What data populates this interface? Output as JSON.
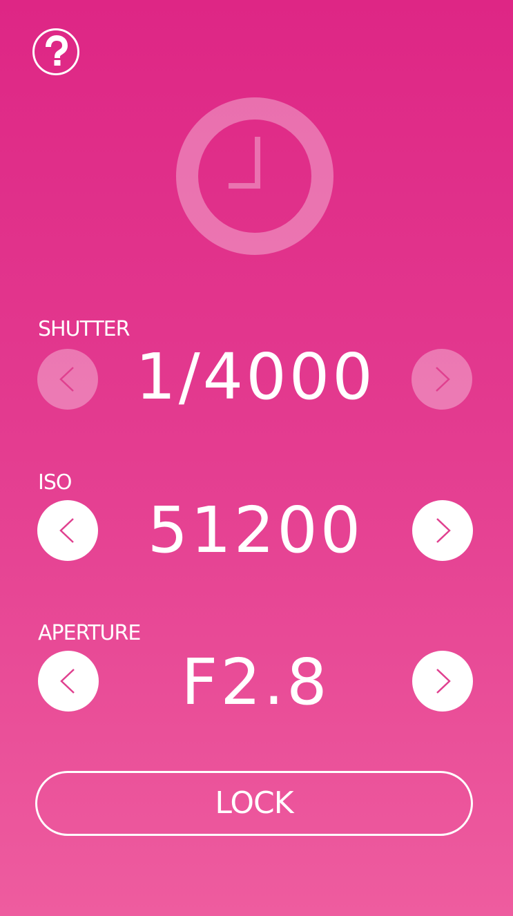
{
  "help": {
    "icon": "question-mark-icon"
  },
  "timer": {
    "icon": "clock-icon"
  },
  "shutter": {
    "label": "SHUTTER",
    "value": "1/4000",
    "prev_icon": "chevron-left-icon",
    "next_icon": "chevron-right-icon",
    "prev_enabled": false,
    "next_enabled": false
  },
  "iso": {
    "label": "ISO",
    "value": "51200",
    "prev_icon": "chevron-left-icon",
    "next_icon": "chevron-right-icon",
    "prev_enabled": true,
    "next_enabled": true
  },
  "aperture": {
    "label": "APERTURE",
    "value": "F2.8",
    "prev_icon": "chevron-left-icon",
    "next_icon": "chevron-right-icon",
    "prev_enabled": true,
    "next_enabled": true
  },
  "lock": {
    "label": "LOCK"
  },
  "colors": {
    "background_top": "#de2685",
    "background_bottom": "#ee5c9f",
    "foreground": "#ffffff",
    "chevron": "#e0408f"
  }
}
